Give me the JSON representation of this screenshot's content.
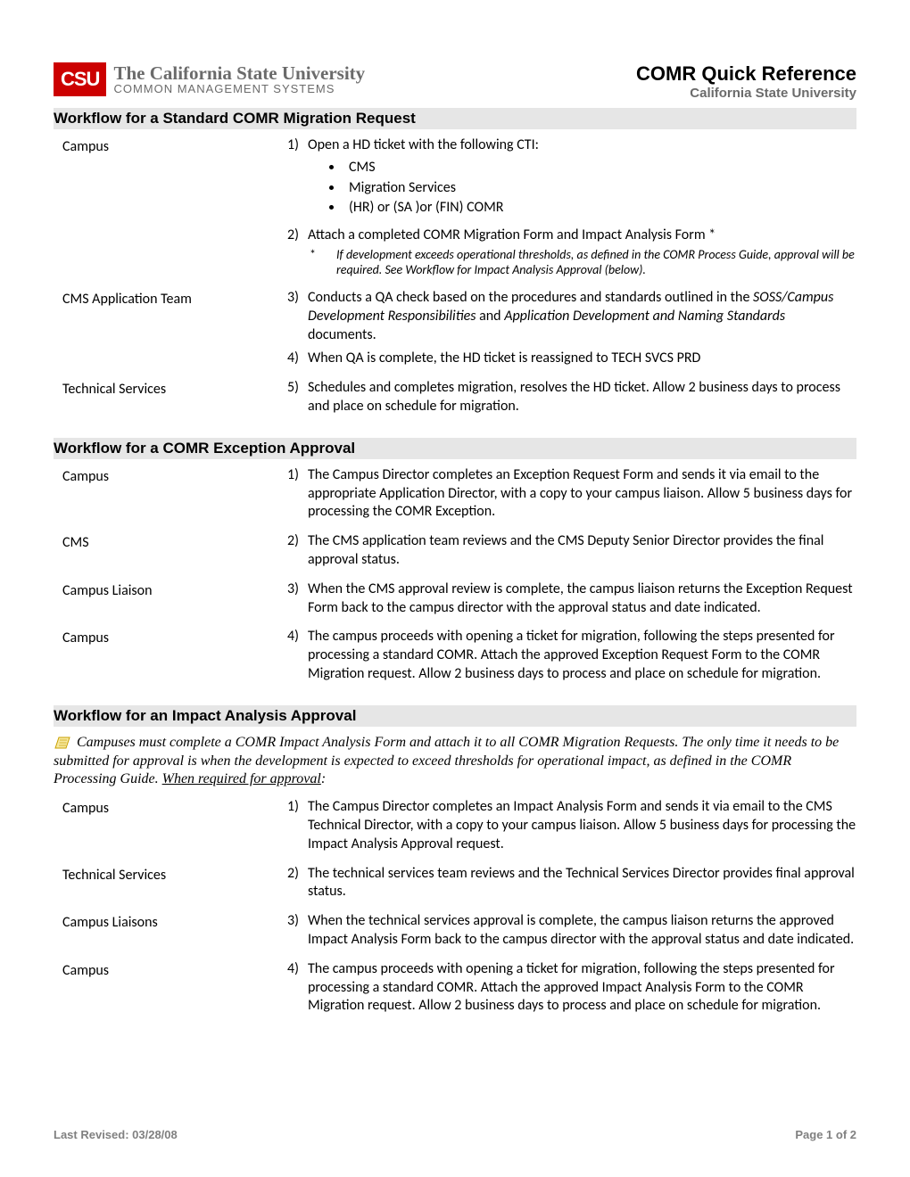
{
  "header": {
    "logo_abbr": "CSU",
    "logo_line1": "The California State University",
    "logo_line2": "COMMON MANAGEMENT SYSTEMS",
    "doc_title": "COMR Quick Reference",
    "doc_subtitle": "California State University"
  },
  "section1": {
    "title": "Workflow for a Standard COMR Migration Request",
    "rows": [
      {
        "actor": "Campus",
        "steps": [
          {
            "num": "1)",
            "text": "Open a HD ticket with the following CTI:",
            "bullets": [
              "CMS",
              "Migration Services",
              "(HR) or (SA )or (FIN) COMR"
            ]
          },
          {
            "num": "2)",
            "text": "Attach a completed COMR Migration Form and Impact Analysis Form *",
            "footnote_star": "*",
            "footnote": "If development exceeds operational thresholds, as defined in the COMR Process Guide, approval will be required.  See Workflow for Impact Analysis Approval (below)."
          }
        ]
      },
      {
        "actor": "CMS Application Team",
        "steps": [
          {
            "num": "3)",
            "pre": "Conducts a QA check based on the procedures and standards outlined in the ",
            "italic": "SOSS/Campus Development Responsibilities",
            "mid": " and ",
            "italic2": "Application Development and Naming Standards",
            "post": " documents."
          },
          {
            "num": "4)",
            "text": "When QA is complete,  the HD ticket is reassigned to TECH SVCS PRD"
          }
        ]
      },
      {
        "actor": "Technical Services",
        "steps": [
          {
            "num": "5)",
            "text": "Schedules and completes migration, resolves the HD ticket.   Allow 2 business days to process and place on schedule for migration."
          }
        ]
      }
    ]
  },
  "section2": {
    "title": "Workflow for a COMR Exception Approval",
    "rows": [
      {
        "actor": "Campus",
        "steps": [
          {
            "num": "1)",
            "text": "The Campus Director completes an Exception Request Form and sends it via email to the appropriate Application Director, with a copy to your campus liaison.  Allow 5 business days for processing the COMR Exception."
          }
        ]
      },
      {
        "actor": "CMS",
        "steps": [
          {
            "num": "2)",
            "text": "The CMS application team reviews and the CMS Deputy Senior Director provides the final approval status."
          }
        ]
      },
      {
        "actor": "Campus Liaison",
        "steps": [
          {
            "num": "3)",
            "text": "When the CMS approval review is complete, the campus liaison returns the Exception Request Form back to the campus director with the approval status and date indicated."
          }
        ]
      },
      {
        "actor": "Campus",
        "steps": [
          {
            "num": "4)",
            "text": "The campus proceeds with opening a ticket for migration, following the steps presented for processing a standard COMR.  Attach the approved Exception Request Form to the COMR Migration request.  Allow 2 business days to process and place on schedule for migration."
          }
        ]
      }
    ]
  },
  "section3": {
    "title": "Workflow for an Impact Analysis Approval",
    "note_pre": "Campuses must complete a COMR Impact Analysis Form and attach it to all COMR Migration Requests.  The only time it needs to be submitted for approval is when the development is expected to exceed thresholds for operational impact, as defined in the COMR Processing Guide.  ",
    "note_underline": "When required for approval",
    "note_post": ":",
    "rows": [
      {
        "actor": "Campus",
        "steps": [
          {
            "num": "1)",
            "text": "The Campus Director completes an Impact Analysis Form and sends it via email to the CMS Technical Director, with a copy to your campus liaison.   Allow 5 business days for processing the Impact Analysis Approval request."
          }
        ]
      },
      {
        "actor": "Technical Services",
        "steps": [
          {
            "num": "2)",
            "text": "The technical services team reviews and the Technical Services Director provides final approval status."
          }
        ]
      },
      {
        "actor": "Campus Liaisons",
        "steps": [
          {
            "num": "3)",
            "text": "When the technical services approval is complete, the campus liaison returns the approved Impact Analysis Form back to the campus director with the approval status and date indicated."
          }
        ]
      },
      {
        "actor": "Campus",
        "steps": [
          {
            "num": "4)",
            "text": "The campus proceeds with opening a ticket for migration, following the steps presented for processing a standard COMR.  Attach the approved Impact Analysis Form to the COMR Migration request.  Allow 2 business days to process and place on schedule for migration."
          }
        ]
      }
    ]
  },
  "footer": {
    "left": "Last Revised: 03/28/08",
    "right": "Page 1 of 2"
  }
}
